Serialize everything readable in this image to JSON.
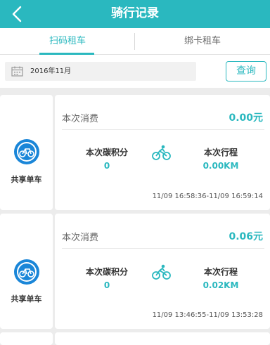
{
  "header": {
    "title": "骑行记录",
    "back_icon": "chevron-left-icon"
  },
  "tabs": [
    {
      "label": "扫码租车",
      "active": true
    },
    {
      "label": "绑卡租车",
      "active": false
    }
  ],
  "filter": {
    "date_value": "2016年11月",
    "query_label": "查询",
    "calendar_icon": "calendar-icon"
  },
  "colors": {
    "accent": "#2ab8bf",
    "background": "#ececec"
  },
  "records": [
    {
      "brand": "共享单车",
      "cost_label": "本次消费",
      "cost_value": "0.00元",
      "carbon_label": "本次碳积分",
      "carbon_value": "0",
      "distance_label": "本次行程",
      "distance_value": "0.00KM",
      "time_range": "11/09 16:58:36-11/09 16:59:14"
    },
    {
      "brand": "共享单车",
      "cost_label": "本次消费",
      "cost_value": "0.06元",
      "carbon_label": "本次碳积分",
      "carbon_value": "0",
      "distance_label": "本次行程",
      "distance_value": "0.02KM",
      "time_range": "11/09 13:46:55-11/09 13:53:28"
    }
  ]
}
